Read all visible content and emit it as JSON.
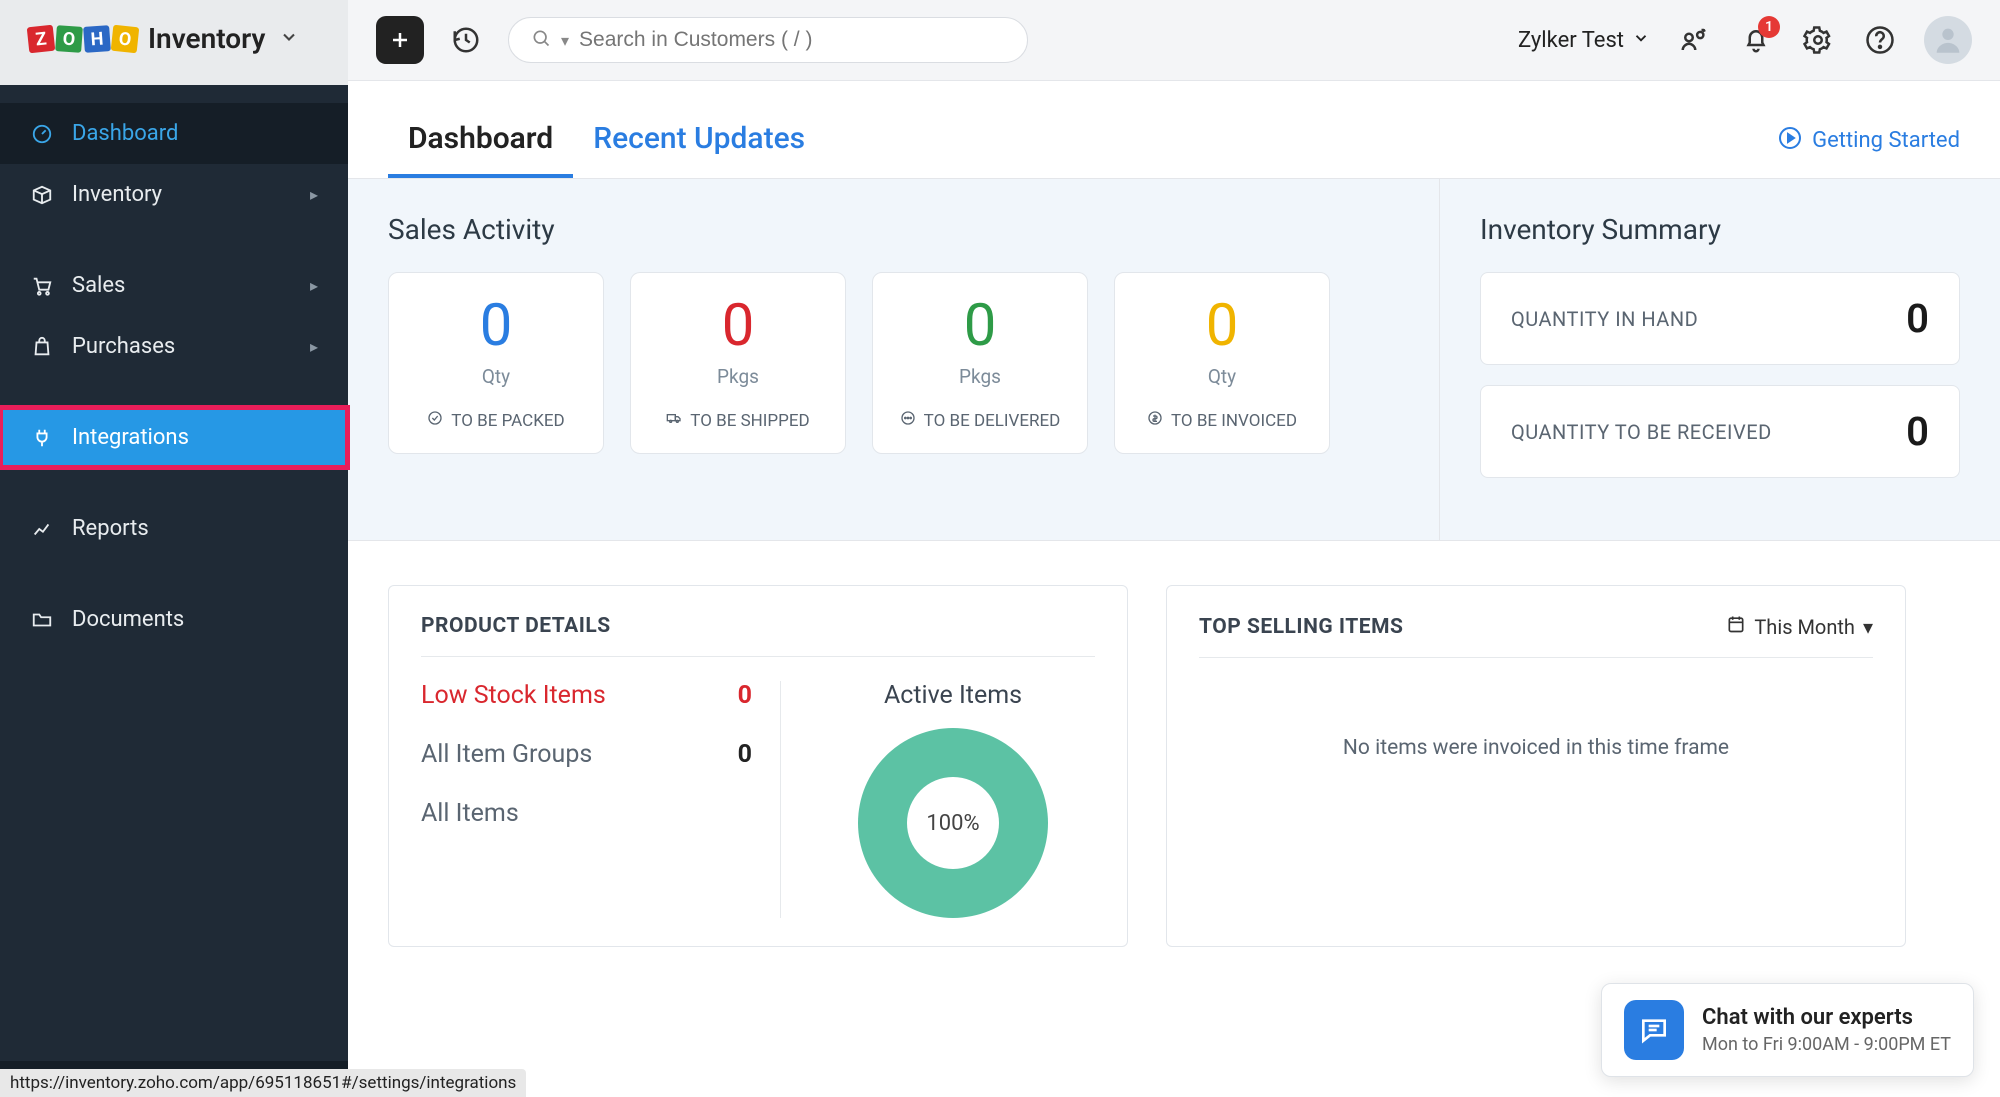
{
  "brand": {
    "name": "Inventory"
  },
  "sidebar": {
    "items": [
      {
        "label": "Dashboard"
      },
      {
        "label": "Inventory"
      },
      {
        "label": "Sales"
      },
      {
        "label": "Purchases"
      },
      {
        "label": "Integrations"
      },
      {
        "label": "Reports"
      },
      {
        "label": "Documents"
      }
    ]
  },
  "header": {
    "search_placeholder": "Search in Customers ( / )",
    "org_name": "Zylker Test",
    "notification_count": "1"
  },
  "tabs": {
    "dashboard": "Dashboard",
    "recent_updates": "Recent Updates",
    "getting_started": "Getting Started"
  },
  "sales_activity": {
    "title": "Sales Activity",
    "cards": [
      {
        "value": "0",
        "unit": "Qty",
        "label": "TO BE PACKED",
        "color": "#2a7de1"
      },
      {
        "value": "0",
        "unit": "Pkgs",
        "label": "TO BE SHIPPED",
        "color": "#d9272e"
      },
      {
        "value": "0",
        "unit": "Pkgs",
        "label": "TO BE DELIVERED",
        "color": "#2e9b47"
      },
      {
        "value": "0",
        "unit": "Qty",
        "label": "TO BE INVOICED",
        "color": "#f0b400"
      }
    ]
  },
  "inventory_summary": {
    "title": "Inventory Summary",
    "rows": [
      {
        "label": "QUANTITY IN HAND",
        "value": "0"
      },
      {
        "label": "QUANTITY TO BE RECEIVED",
        "value": "0"
      }
    ]
  },
  "product_details": {
    "title": "PRODUCT DETAILS",
    "rows": [
      {
        "label": "Low Stock Items",
        "value": "0",
        "low": true
      },
      {
        "label": "All Item Groups",
        "value": "0"
      },
      {
        "label": "All Items",
        "value": ""
      }
    ],
    "donut": {
      "title": "Active Items",
      "center": "100%"
    }
  },
  "top_selling": {
    "title": "TOP SELLING ITEMS",
    "period": "This Month",
    "empty": "No items were invoiced in this time frame"
  },
  "chat": {
    "title": "Chat with our experts",
    "hours": "Mon to Fri 9:00AM - 9:00PM ET"
  },
  "status_url": "https://inventory.zoho.com/app/695118651#/settings/integrations",
  "chart_data": {
    "type": "pie",
    "title": "Active Items",
    "series": [
      {
        "name": "Active",
        "value": 100
      }
    ],
    "center_label": "100%"
  }
}
